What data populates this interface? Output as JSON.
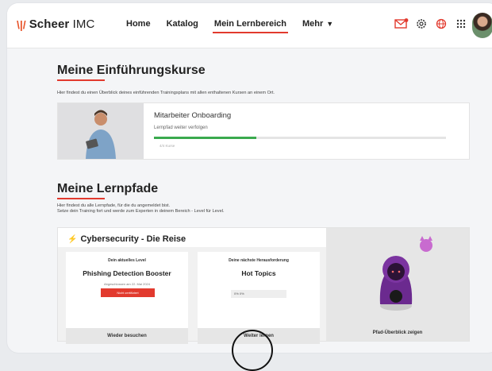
{
  "brand": {
    "mark": "\\|/",
    "name_bold": "Scheer",
    "name_rest": " IMC"
  },
  "nav": [
    {
      "label": "Home"
    },
    {
      "label": "Katalog"
    },
    {
      "label": "Mein Lernbereich",
      "active": true
    },
    {
      "label": "Mehr"
    }
  ],
  "icons": [
    "mail-icon",
    "gear-icon",
    "globe-icon",
    "apps-grid-icon"
  ],
  "accent": "#e23a2e",
  "intro": {
    "heading": "Meine Einführungskurse",
    "description": "Hier findest du einen Überblick deines einführenden Trainingsplans mit allen enthaltenen Kursen an einem Ort.",
    "course": {
      "title": "Mitarbeiter Onboarding",
      "link": "Lernpfad weiter verfolgen",
      "progress": 0.35,
      "meta": "4/4 Kurse"
    }
  },
  "paths": {
    "heading": "Meine Lernpfade",
    "description_1": "Hier findest du alle Lernpfade, für die du angemeldet bist.",
    "description_2": "Setze dein Training fort und werde zum Experten in deinem Bereich - Level für Level.",
    "path": {
      "title": "Cybersecurity - Die Reise",
      "current": {
        "label": "Dein aktuelles Level",
        "name": "Phishing Detection Booster",
        "meta": "Abgeschlossen am 22. Mai 2024",
        "button": "Nicht zertifiziert",
        "footer": "Wieder besuchen"
      },
      "next": {
        "label": "Deine nächste Herausforderung",
        "name": "Hot Topics",
        "progress_text": "0% 0%",
        "footer": "Weiter lernen"
      },
      "overview_button": "Pfad-Überblick zeigen"
    }
  }
}
